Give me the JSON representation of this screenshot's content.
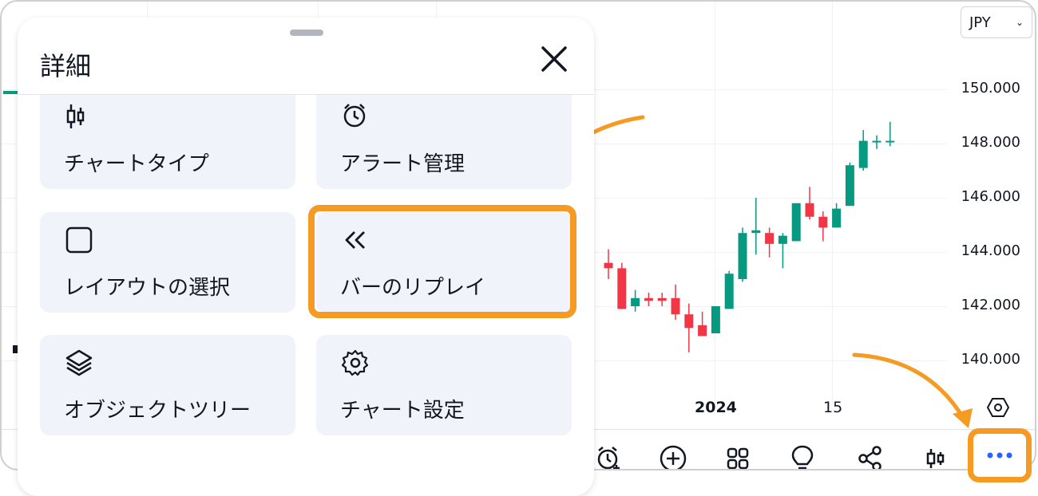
{
  "currency": {
    "value": "JPY"
  },
  "price_axis": [
    "150.000",
    "148.000",
    "146.000",
    "144.000",
    "142.000",
    "140.000"
  ],
  "time_axis": {
    "year": "2024",
    "day": "15"
  },
  "panel": {
    "title": "詳細",
    "items": [
      {
        "label": "チャートタイプ",
        "icon": "candles-icon"
      },
      {
        "label": "アラート管理",
        "icon": "alarm-clock-icon"
      },
      {
        "label": "レイアウトの選択",
        "icon": "square-icon"
      },
      {
        "label": "バーのリプレイ",
        "icon": "rewind-icon",
        "highlighted": true
      },
      {
        "label": "オブジェクトツリー",
        "icon": "layers-icon"
      },
      {
        "label": "チャート設定",
        "icon": "gear-icon"
      }
    ]
  },
  "colors": {
    "up": "#089981",
    "down": "#f23645",
    "highlight": "#f59a23",
    "accent": "#2962ff"
  },
  "candles": [
    {
      "o": 143.6,
      "h": 144.1,
      "l": 143.0,
      "c": 143.4
    },
    {
      "o": 143.4,
      "h": 143.6,
      "l": 141.9,
      "c": 141.9
    },
    {
      "o": 142.0,
      "h": 142.6,
      "l": 141.8,
      "c": 142.3
    },
    {
      "o": 142.3,
      "h": 142.5,
      "l": 142.0,
      "c": 142.2
    },
    {
      "o": 142.3,
      "h": 142.5,
      "l": 142.0,
      "c": 142.2
    },
    {
      "o": 142.3,
      "h": 142.8,
      "l": 141.5,
      "c": 141.7
    },
    {
      "o": 141.7,
      "h": 142.1,
      "l": 140.3,
      "c": 141.2
    },
    {
      "o": 141.3,
      "h": 141.8,
      "l": 140.9,
      "c": 140.9
    },
    {
      "o": 141.0,
      "h": 142.0,
      "l": 141.0,
      "c": 142.0
    },
    {
      "o": 141.9,
      "h": 143.3,
      "l": 141.9,
      "c": 143.2
    },
    {
      "o": 143.0,
      "h": 144.9,
      "l": 142.9,
      "c": 144.7
    },
    {
      "o": 144.7,
      "h": 146.0,
      "l": 143.9,
      "c": 144.8
    },
    {
      "o": 144.7,
      "h": 144.9,
      "l": 143.8,
      "c": 144.3
    },
    {
      "o": 144.3,
      "h": 144.7,
      "l": 143.4,
      "c": 144.6
    },
    {
      "o": 144.4,
      "h": 145.8,
      "l": 144.4,
      "c": 145.8
    },
    {
      "o": 145.8,
      "h": 146.4,
      "l": 145.2,
      "c": 145.3
    },
    {
      "o": 145.3,
      "h": 145.5,
      "l": 144.4,
      "c": 144.9
    },
    {
      "o": 144.9,
      "h": 145.8,
      "l": 144.9,
      "c": 145.6
    },
    {
      "o": 145.7,
      "h": 147.3,
      "l": 145.7,
      "c": 147.2
    },
    {
      "o": 147.1,
      "h": 148.5,
      "l": 147.0,
      "c": 148.1
    },
    {
      "o": 148.1,
      "h": 148.3,
      "l": 147.8,
      "c": 148.1
    },
    {
      "o": 148.1,
      "h": 148.8,
      "l": 147.9,
      "c": 148.1
    }
  ],
  "toolbar": [
    "alarm-add-icon",
    "plus-circle-icon",
    "grid-icon",
    "idea-bulb-icon",
    "share-icon",
    "candles-icon",
    "more-dots-icon"
  ]
}
